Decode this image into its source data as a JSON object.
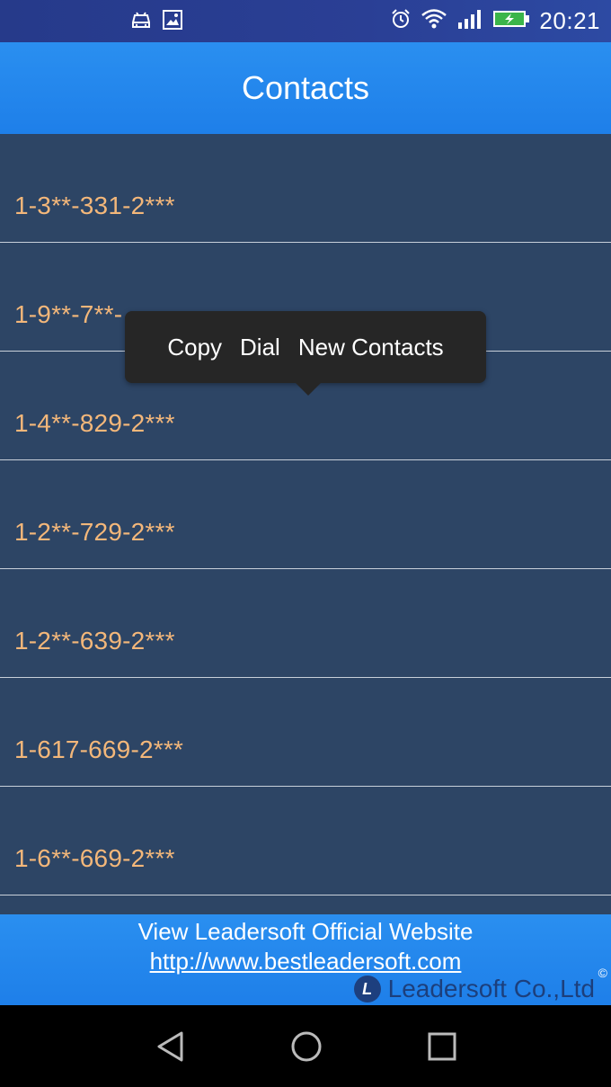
{
  "status_bar": {
    "time": "20:21",
    "left_icons": [
      "android-debug-icon",
      "image-icon"
    ],
    "right_icons": [
      "alarm-icon",
      "wifi-icon",
      "signal-icon",
      "battery-charging-icon"
    ]
  },
  "header": {
    "title": "Contacts"
  },
  "contacts": [
    "1-3**-331-2***",
    "1-9**-7**-",
    "1-4**-829-2***",
    "1-2**-729-2***",
    "1-2**-639-2***",
    "1-617-669-2***",
    "1-6**-669-2***"
  ],
  "popup": {
    "copy": "Copy",
    "dial": "Dial",
    "new_contacts": "New Contacts"
  },
  "footer": {
    "line1": "View Leadersoft Official Website",
    "link": "http://www.bestleadersoft.com",
    "brand": "Leadersoft Co.,Ltd",
    "brand_mark": "©",
    "logo_letter": "L"
  },
  "nav": [
    "back-icon",
    "home-icon",
    "recents-icon"
  ],
  "colors": {
    "accent": "#1e7fe9",
    "list_bg": "#2d4565",
    "number_text": "#f3b77a"
  }
}
